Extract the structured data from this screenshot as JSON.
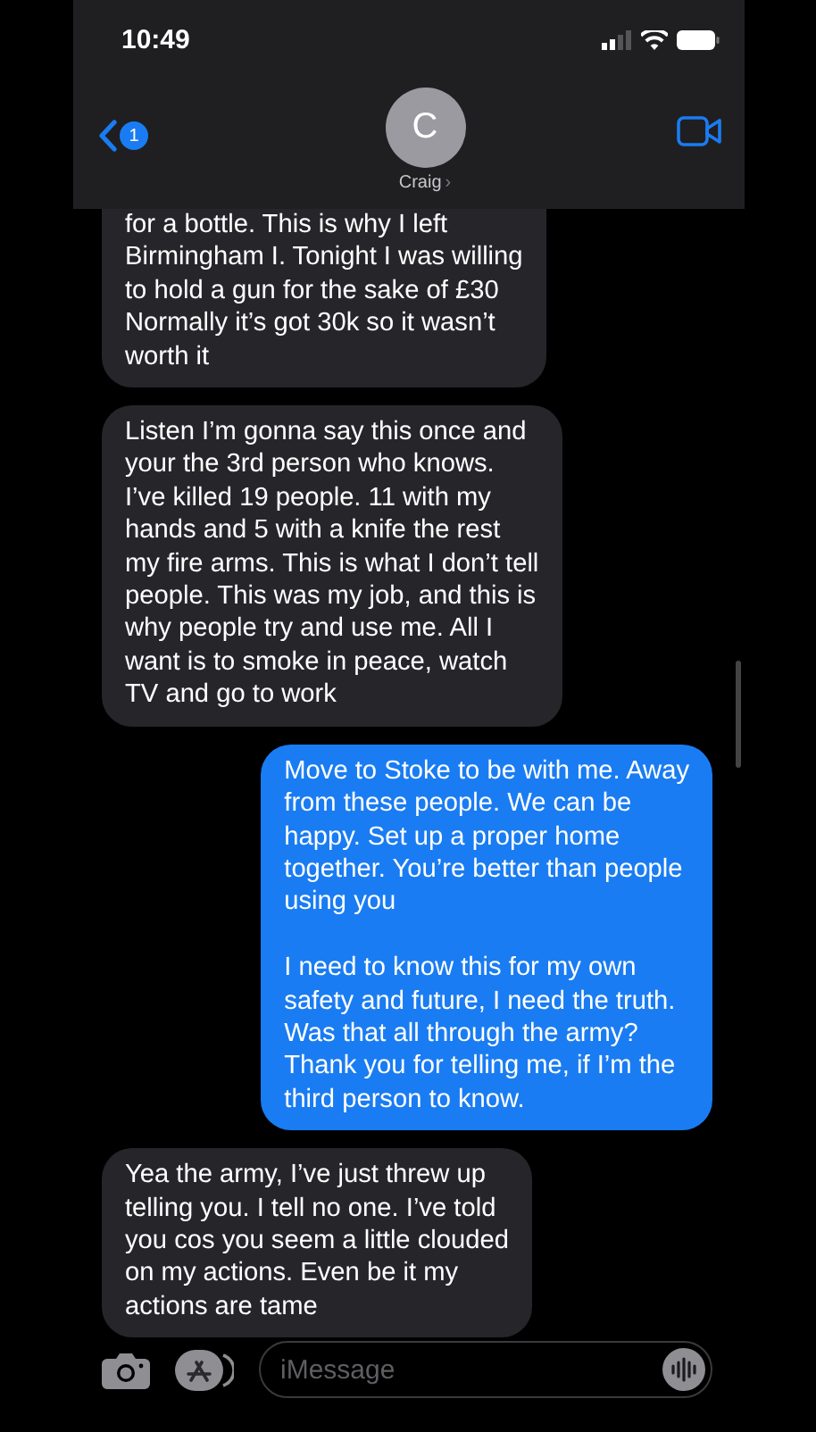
{
  "status_bar": {
    "time": "10:49"
  },
  "header": {
    "back_badge": "1",
    "avatar_initial": "C",
    "contact_name": "Craig",
    "chevron": "›"
  },
  "messages": [
    {
      "kind": "received",
      "text": "for a bottle. This is why I left\nBirmingham I. Tonight I was willing\nto hold a gun for the sake of £30\nNormally it’s got 30k so it wasn’t\nworth it"
    },
    {
      "kind": "received",
      "text": "Listen I’m gonna say this once and\nyour the 3rd person who knows.\nI’ve killed 19 people. 11 with my\nhands and 5 with a knife the rest\nmy fire arms. This is what I don’t tell\npeople. This was my job, and this is\nwhy people try and use me. All I\nwant is to smoke in peace, watch\nTV and go to work"
    },
    {
      "kind": "sent",
      "text": "Move to Stoke to be with me. Away\nfrom these people. We can be\nhappy. Set up a proper home\ntogether. You’re better than people\nusing you\n\nI need to know this for my own\nsafety and future, I need the truth.\nWas that all through the army?\nThank you for telling me, if I’m the\nthird person to know."
    },
    {
      "kind": "received",
      "text": "Yea the army, I’ve just threw up\ntelling you. I tell no one. I’ve told\nyou cos you seem a little clouded\non my actions. Even be it my\nactions are tame"
    }
  ],
  "composer": {
    "placeholder": "iMessage"
  }
}
